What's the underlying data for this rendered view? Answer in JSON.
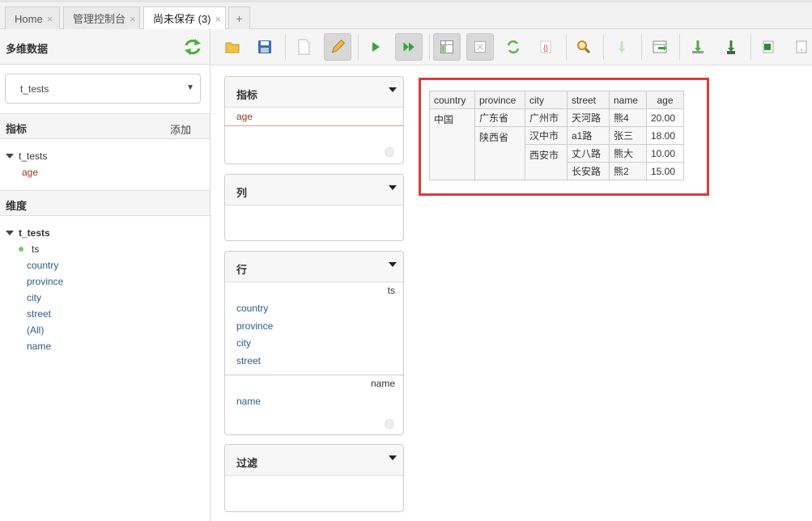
{
  "tabs": [
    {
      "label": "Home",
      "close": "×"
    },
    {
      "label": "管理控制台",
      "close": "×"
    },
    {
      "label": "尚未保存 (3)",
      "close": "×"
    }
  ],
  "tab_add": "+",
  "sidebar": {
    "title": "多维数据",
    "cube_select": "t_tests",
    "measures_section": {
      "title": "指标",
      "add_label": "添加"
    },
    "measures_tree": {
      "root": "t_tests",
      "items": [
        "age"
      ]
    },
    "dimensions_section": {
      "title": "维度"
    },
    "dimensions_tree": {
      "root": "t_tests",
      "hierarchy": "ts",
      "levels": [
        "country",
        "province",
        "city",
        "street",
        "(All)",
        "name"
      ]
    }
  },
  "panels": {
    "measures": {
      "title": "指标",
      "items": [
        "age"
      ]
    },
    "columns": {
      "title": "列"
    },
    "rows": {
      "title": "行",
      "groups": [
        {
          "hierarchy": "ts",
          "levels": [
            "country",
            "province",
            "city",
            "street"
          ]
        },
        {
          "hierarchy": "name",
          "levels": [
            "name"
          ]
        }
      ]
    },
    "filter": {
      "title": "过滤"
    }
  },
  "pivot": {
    "headers": [
      "country",
      "province",
      "city",
      "street",
      "name",
      "age"
    ],
    "rows": [
      [
        "中国",
        "广东省",
        "广州市",
        "天河路",
        "熊4",
        "20.00"
      ],
      [
        "",
        "陕西省",
        "汉中市",
        "a1路",
        "张三",
        "18.00"
      ],
      [
        "",
        "",
        "西安市",
        "丈八路",
        "熊大",
        "10.00"
      ],
      [
        "",
        "",
        "",
        "长安路",
        "熊2",
        "15.00"
      ]
    ]
  },
  "colors": {
    "highlight_border": "#e03a3a",
    "measure_text": "#8b3a1e",
    "link_text": "#2a5b8a",
    "play_green": "#3aa33a"
  }
}
